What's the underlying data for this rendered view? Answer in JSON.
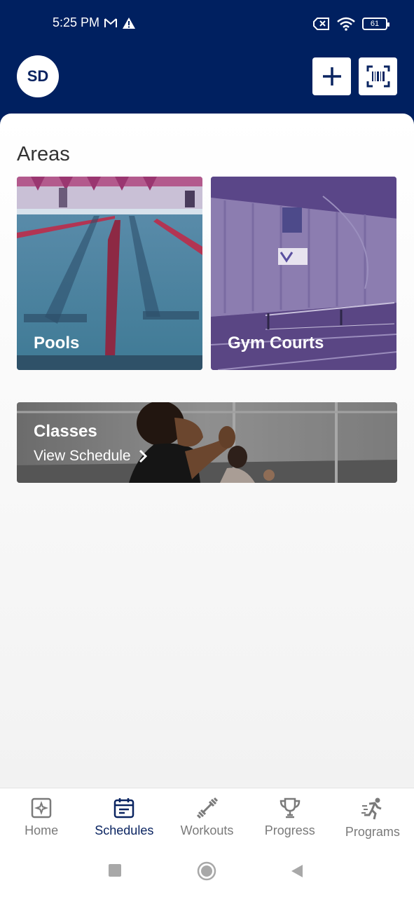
{
  "status": {
    "time": "5:25 PM",
    "battery": "61"
  },
  "header": {
    "avatar_initials": "SD"
  },
  "areas": {
    "title": "Areas",
    "tiles": [
      {
        "label": "Pools"
      },
      {
        "label": "Gym Courts"
      }
    ]
  },
  "classes": {
    "title": "Classes",
    "link_label": "View Schedule"
  },
  "tabs": [
    {
      "label": "Home",
      "icon": "home-icon"
    },
    {
      "label": "Schedules",
      "icon": "calendar-icon",
      "active": true
    },
    {
      "label": "Workouts",
      "icon": "dumbbell-icon"
    },
    {
      "label": "Progress",
      "icon": "trophy-icon"
    },
    {
      "label": "Programs",
      "icon": "runner-icon"
    }
  ],
  "colors": {
    "brand": "#002060",
    "active_tab": "#0a2461",
    "inactive_tab": "#7a7a7a"
  }
}
